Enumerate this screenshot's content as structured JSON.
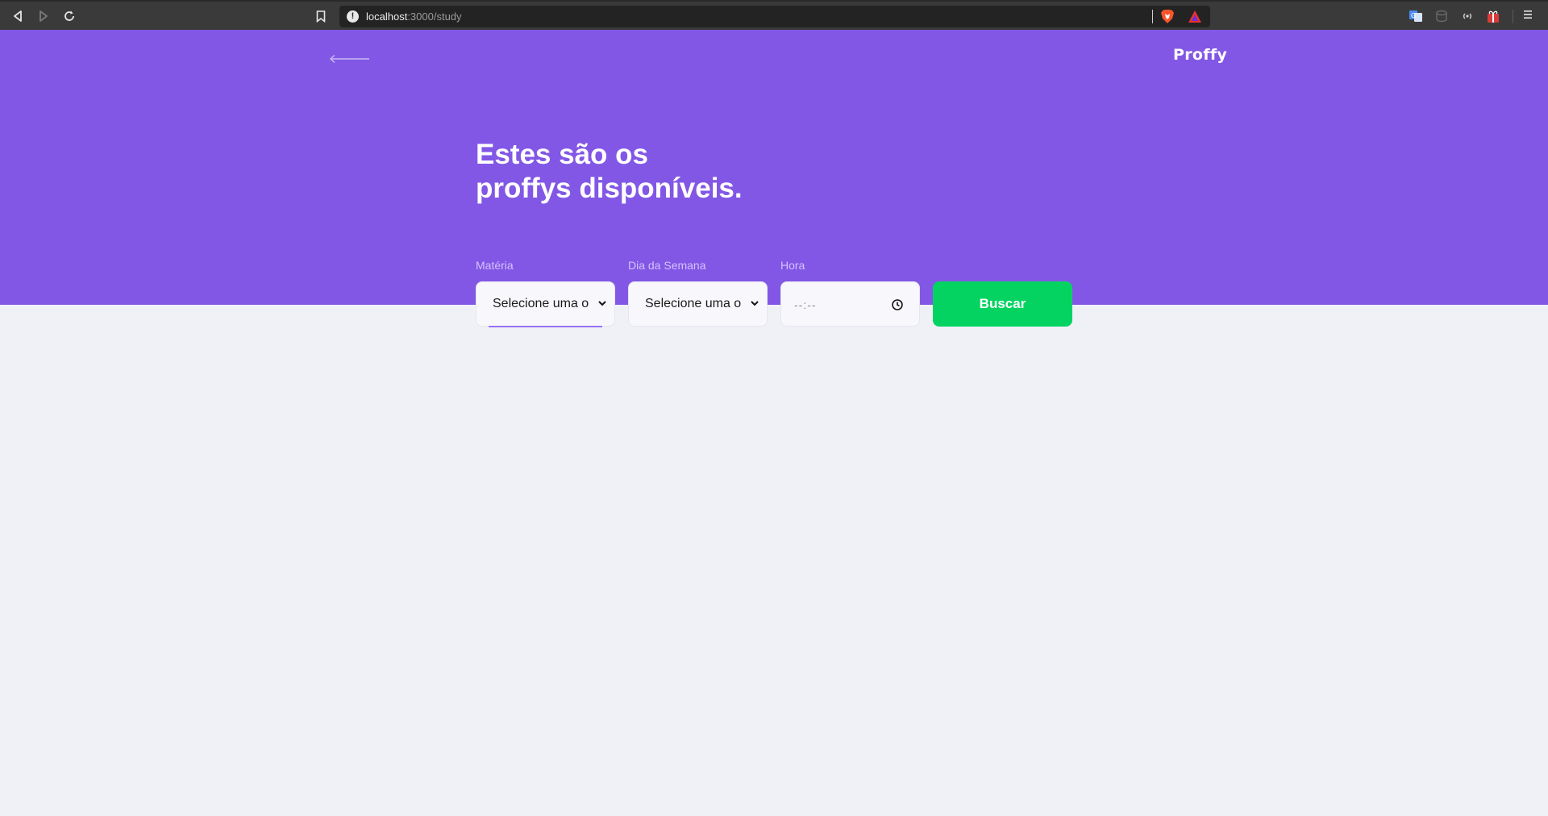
{
  "browser": {
    "url_host": "localhost",
    "url_path": ":3000/study"
  },
  "header": {
    "brand": "Proffy",
    "back_icon": "arrow-left-icon"
  },
  "hero": {
    "title_line1": "Estes são os",
    "title_line2": "proffys disponíveis."
  },
  "filters": {
    "subject": {
      "label": "Matéria",
      "value": "Selecione uma o"
    },
    "weekday": {
      "label": "Dia da Semana",
      "value": "Selecione uma o"
    },
    "time": {
      "label": "Hora",
      "placeholder": "--:--"
    },
    "submit_label": "Buscar"
  },
  "colors": {
    "primary": "#8257e5",
    "secondary": "#04d361",
    "background": "#f0f0f7"
  }
}
